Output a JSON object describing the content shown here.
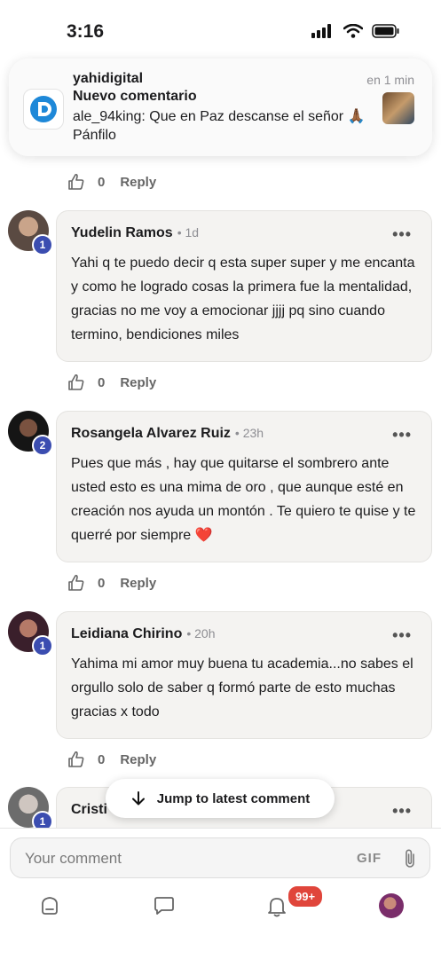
{
  "status_bar": {
    "time": "3:16"
  },
  "notification": {
    "app": "yahidigital",
    "title": "Nuevo comentario",
    "body": "ale_94king: Que en Paz descanse el señor 🙏🏾 Pánfilo",
    "time": "en 1 min"
  },
  "previous_reply": {
    "likes": "0",
    "reply_label": "Reply"
  },
  "comments": [
    {
      "name": "Yudelin Ramos",
      "time": "• 1d",
      "level": "1",
      "body": "Yahi q te puedo decir q esta super super y me encanta y como he logrado cosas la primera fue la mentalidad, gracias no me voy a emocionar jjjj pq sino cuando termino, bendiciones miles",
      "likes": "0",
      "reply_label": "Reply"
    },
    {
      "name": "Rosangela Alvarez Ruiz",
      "time": "• 23h",
      "level": "2",
      "body": "Pues que más , hay que quitarse el sombrero ante usted esto es una mima de oro , que aunque esté en creación nos ayuda un montón . Te quiero te quise y te querré por siempre ❤️",
      "likes": "0",
      "reply_label": "Reply"
    },
    {
      "name": "Leidiana Chirino",
      "time": "• 20h",
      "level": "1",
      "body": "Yahima mi amor muy buena tu academia...no sabes el orgullo solo de saber q formó parte de esto muchas gracias x todo",
      "likes": "0",
      "reply_label": "Reply"
    },
    {
      "name": "Cristi",
      "time": "",
      "level": "1",
      "body": ""
    }
  ],
  "more_label": "•••",
  "jump_button": {
    "label": "Jump to latest comment"
  },
  "composer": {
    "placeholder": "Your comment",
    "gif_label": "GIF"
  },
  "nav": {
    "notification_count": "99+"
  },
  "colors": {
    "accent": "#3b4db0",
    "badge_red": "#e0453b",
    "card_bg": "#f4f3f1"
  }
}
